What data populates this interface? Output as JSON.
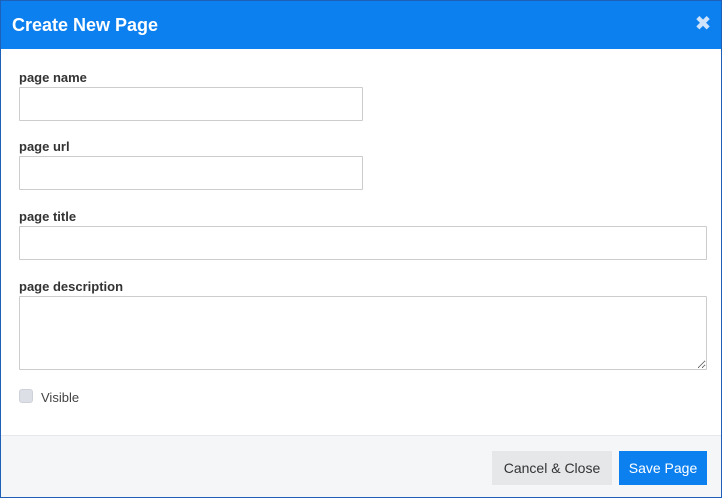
{
  "dialog": {
    "title": "Create New Page",
    "close_icon": "close-icon",
    "accent_color": "#0d80f0"
  },
  "form": {
    "page_name": {
      "label": "page name",
      "value": "",
      "placeholder": ""
    },
    "page_url": {
      "label": "page url",
      "value": "",
      "placeholder": ""
    },
    "page_title": {
      "label": "page title",
      "value": "",
      "placeholder": ""
    },
    "page_description": {
      "label": "page description",
      "value": "",
      "placeholder": ""
    },
    "visible": {
      "label": "Visible",
      "checked": false
    }
  },
  "footer": {
    "cancel_label": "Cancel & Close",
    "save_label": "Save Page"
  }
}
